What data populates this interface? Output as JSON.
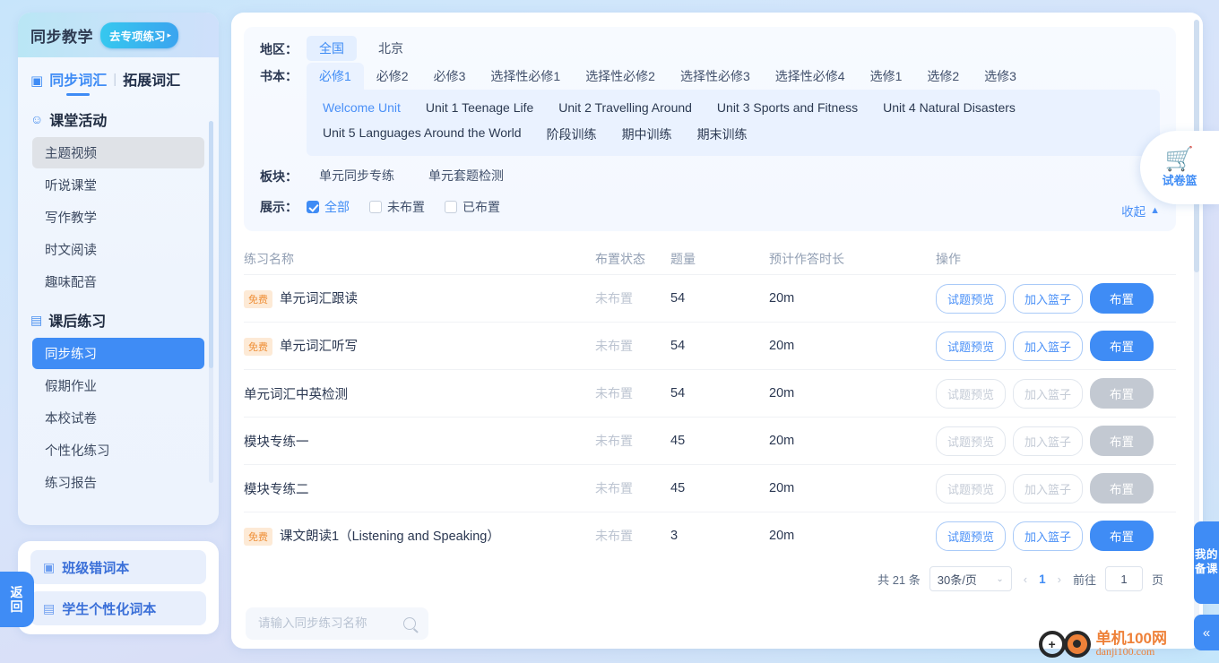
{
  "sidebar": {
    "title": "同步教学",
    "special_button": "去专项练习",
    "special_arrow": "▸",
    "tab_sync": "同步词汇",
    "tab_extend": "拓展词汇",
    "divider": "|",
    "groups": [
      {
        "icon": "person-icon",
        "title": "课堂活动",
        "items": [
          {
            "label": "主题视频",
            "state": "hover"
          },
          {
            "label": "听说课堂",
            "state": "normal"
          },
          {
            "label": "写作教学",
            "state": "normal"
          },
          {
            "label": "时文阅读",
            "state": "normal"
          },
          {
            "label": "趣味配音",
            "state": "normal"
          }
        ]
      },
      {
        "icon": "clipboard-icon",
        "title": "课后练习",
        "items": [
          {
            "label": "同步练习",
            "state": "active"
          },
          {
            "label": "假期作业",
            "state": "normal"
          },
          {
            "label": "本校试卷",
            "state": "normal"
          },
          {
            "label": "个性化练习",
            "state": "normal"
          },
          {
            "label": "练习报告",
            "state": "normal"
          }
        ]
      }
    ],
    "bottom_items": [
      {
        "label": "班级错词本",
        "icon": "notebook-icon"
      },
      {
        "label": "学生个性化词本",
        "icon": "book-icon"
      }
    ],
    "back_label": "返回"
  },
  "filter": {
    "region_label": "地区：",
    "regions": [
      {
        "label": "全国",
        "selected": true
      },
      {
        "label": "北京",
        "selected": false
      }
    ],
    "book_label": "书本：",
    "books": [
      {
        "label": "必修1",
        "selected": true
      },
      {
        "label": "必修2",
        "selected": false
      },
      {
        "label": "必修3",
        "selected": false
      },
      {
        "label": "选择性必修1",
        "selected": false
      },
      {
        "label": "选择性必修2",
        "selected": false
      },
      {
        "label": "选择性必修3",
        "selected": false
      },
      {
        "label": "选择性必修4",
        "selected": false
      },
      {
        "label": "选修1",
        "selected": false
      },
      {
        "label": "选修2",
        "selected": false
      },
      {
        "label": "选修3",
        "selected": false
      }
    ],
    "units_row1": [
      {
        "label": "Welcome Unit",
        "selected": true
      },
      {
        "label": "Unit 1 Teenage Life",
        "selected": false
      },
      {
        "label": "Unit 2 Travelling Around",
        "selected": false
      },
      {
        "label": "Unit 3 Sports and Fitness",
        "selected": false
      },
      {
        "label": "Unit 4 Natural Disasters",
        "selected": false
      }
    ],
    "units_row2": [
      {
        "label": "Unit 5 Languages Around the World",
        "selected": false
      },
      {
        "label": "阶段训练",
        "selected": false
      },
      {
        "label": "期中训练",
        "selected": false
      },
      {
        "label": "期末训练",
        "selected": false
      }
    ],
    "section_label": "板块：",
    "sections": [
      {
        "label": "单元同步专练",
        "selected": false
      },
      {
        "label": "单元套题检测",
        "selected": false
      }
    ],
    "display_label": "展示：",
    "display_options": [
      {
        "label": "全部",
        "checked": true
      },
      {
        "label": "未布置",
        "checked": false
      },
      {
        "label": "已布置",
        "checked": false
      }
    ],
    "collapse_label": "收起",
    "collapse_icon": "chevron-up-icon"
  },
  "table": {
    "headers": {
      "name": "练习名称",
      "status": "布置状态",
      "count": "题量",
      "duration": "预计作答时长",
      "actions": "操作"
    },
    "buttons": {
      "preview": "试题预览",
      "add_basket": "加入篮子",
      "assign": "布置"
    },
    "free_badge": "免费",
    "rows": [
      {
        "free": true,
        "name": "单元词汇跟读",
        "status": "未布置",
        "count": "54",
        "duration": "20m",
        "disabled": false
      },
      {
        "free": true,
        "name": "单元词汇听写",
        "status": "未布置",
        "count": "54",
        "duration": "20m",
        "disabled": false
      },
      {
        "free": false,
        "name": "单元词汇中英检测",
        "status": "未布置",
        "count": "54",
        "duration": "20m",
        "disabled": true
      },
      {
        "free": false,
        "name": "模块专练一",
        "status": "未布置",
        "count": "45",
        "duration": "20m",
        "disabled": true
      },
      {
        "free": false,
        "name": "模块专练二",
        "status": "未布置",
        "count": "45",
        "duration": "20m",
        "disabled": true
      },
      {
        "free": true,
        "name": "课文朗读1（Listening and Speaking）",
        "status": "未布置",
        "count": "3",
        "duration": "20m",
        "disabled": false
      }
    ]
  },
  "pagination": {
    "total": "共 21 条",
    "page_size": "30条/页",
    "page_size_caret": "⌄",
    "prev": "‹",
    "current_page": "1",
    "next": "›",
    "goto_label": "前往",
    "goto_value": "1",
    "page_unit": "页"
  },
  "search": {
    "placeholder": "请输入同步练习名称",
    "value": "",
    "icon": "search-icon"
  },
  "floating": {
    "basket_label": "试卷篮",
    "basket_icon": "shopping-cart-icon",
    "my_prep_label": "我的备课",
    "collapse_icon": "double-chevron-left-icon",
    "collapse_glyph": "«"
  },
  "watermark": {
    "title": "单机100网",
    "domain": "danji100.com",
    "plus": "+"
  }
}
